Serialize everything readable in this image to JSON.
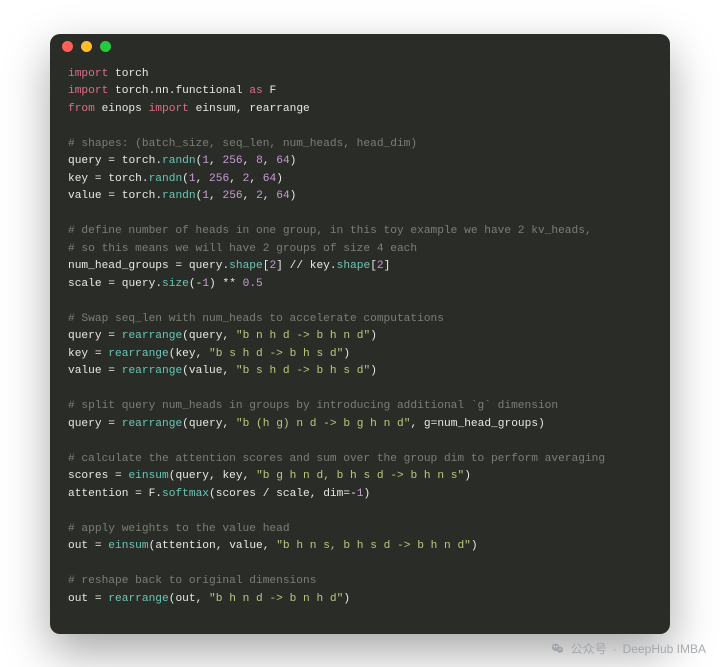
{
  "window": {
    "traffic_lights": [
      "close",
      "minimize",
      "zoom"
    ]
  },
  "code": {
    "lines": [
      {
        "t": [
          [
            "kw",
            "import"
          ],
          [
            "op",
            " "
          ],
          [
            "mod",
            "torch"
          ]
        ]
      },
      {
        "t": [
          [
            "kw",
            "import"
          ],
          [
            "op",
            " "
          ],
          [
            "mod",
            "torch.nn.functional"
          ],
          [
            "op",
            " "
          ],
          [
            "kw",
            "as"
          ],
          [
            "op",
            " "
          ],
          [
            "mod",
            "F"
          ]
        ]
      },
      {
        "t": [
          [
            "kw",
            "from"
          ],
          [
            "op",
            " "
          ],
          [
            "mod",
            "einops"
          ],
          [
            "op",
            " "
          ],
          [
            "kw",
            "import"
          ],
          [
            "op",
            " "
          ],
          [
            "mod",
            "einsum, rearrange"
          ]
        ]
      },
      {
        "t": [
          [
            "op",
            ""
          ]
        ]
      },
      {
        "t": [
          [
            "cmt",
            "# shapes: (batch_size, seq_len, num_heads, head_dim)"
          ]
        ]
      },
      {
        "t": [
          [
            "id",
            "query "
          ],
          [
            "op",
            "= "
          ],
          [
            "id",
            "torch"
          ],
          [
            "op",
            "."
          ],
          [
            "fn",
            "randn"
          ],
          [
            "op",
            "("
          ],
          [
            "num",
            "1"
          ],
          [
            "op",
            ", "
          ],
          [
            "num",
            "256"
          ],
          [
            "op",
            ", "
          ],
          [
            "num",
            "8"
          ],
          [
            "op",
            ", "
          ],
          [
            "num",
            "64"
          ],
          [
            "op",
            ")"
          ]
        ]
      },
      {
        "t": [
          [
            "id",
            "key "
          ],
          [
            "op",
            "= "
          ],
          [
            "id",
            "torch"
          ],
          [
            "op",
            "."
          ],
          [
            "fn",
            "randn"
          ],
          [
            "op",
            "("
          ],
          [
            "num",
            "1"
          ],
          [
            "op",
            ", "
          ],
          [
            "num",
            "256"
          ],
          [
            "op",
            ", "
          ],
          [
            "num",
            "2"
          ],
          [
            "op",
            ", "
          ],
          [
            "num",
            "64"
          ],
          [
            "op",
            ")"
          ]
        ]
      },
      {
        "t": [
          [
            "id",
            "value "
          ],
          [
            "op",
            "= "
          ],
          [
            "id",
            "torch"
          ],
          [
            "op",
            "."
          ],
          [
            "fn",
            "randn"
          ],
          [
            "op",
            "("
          ],
          [
            "num",
            "1"
          ],
          [
            "op",
            ", "
          ],
          [
            "num",
            "256"
          ],
          [
            "op",
            ", "
          ],
          [
            "num",
            "2"
          ],
          [
            "op",
            ", "
          ],
          [
            "num",
            "64"
          ],
          [
            "op",
            ")"
          ]
        ]
      },
      {
        "t": [
          [
            "op",
            ""
          ]
        ]
      },
      {
        "t": [
          [
            "cmt",
            "# define number of heads in one group, in this toy example we have 2 kv_heads,"
          ]
        ]
      },
      {
        "t": [
          [
            "cmt",
            "# so this means we will have 2 groups of size 4 each"
          ]
        ]
      },
      {
        "t": [
          [
            "id",
            "num_head_groups "
          ],
          [
            "op",
            "= "
          ],
          [
            "id",
            "query"
          ],
          [
            "op",
            "."
          ],
          [
            "fn",
            "shape"
          ],
          [
            "op",
            "["
          ],
          [
            "num",
            "2"
          ],
          [
            "op",
            "] // "
          ],
          [
            "id",
            "key"
          ],
          [
            "op",
            "."
          ],
          [
            "fn",
            "shape"
          ],
          [
            "op",
            "["
          ],
          [
            "num",
            "2"
          ],
          [
            "op",
            "]"
          ]
        ]
      },
      {
        "t": [
          [
            "id",
            "scale "
          ],
          [
            "op",
            "= "
          ],
          [
            "id",
            "query"
          ],
          [
            "op",
            "."
          ],
          [
            "fn",
            "size"
          ],
          [
            "op",
            "("
          ],
          [
            "op",
            "-"
          ],
          [
            "num",
            "1"
          ],
          [
            "op",
            ") ** "
          ],
          [
            "num",
            "0.5"
          ]
        ]
      },
      {
        "t": [
          [
            "op",
            ""
          ]
        ]
      },
      {
        "t": [
          [
            "cmt",
            "# Swap seq_len with num_heads to accelerate computations"
          ]
        ]
      },
      {
        "t": [
          [
            "id",
            "query "
          ],
          [
            "op",
            "= "
          ],
          [
            "fn",
            "rearrange"
          ],
          [
            "op",
            "("
          ],
          [
            "id",
            "query"
          ],
          [
            "op",
            ", "
          ],
          [
            "str",
            "\"b n h d -> b h n d\""
          ],
          [
            "op",
            ")"
          ]
        ]
      },
      {
        "t": [
          [
            "id",
            "key "
          ],
          [
            "op",
            "= "
          ],
          [
            "fn",
            "rearrange"
          ],
          [
            "op",
            "("
          ],
          [
            "id",
            "key"
          ],
          [
            "op",
            ", "
          ],
          [
            "str",
            "\"b s h d -> b h s d\""
          ],
          [
            "op",
            ")"
          ]
        ]
      },
      {
        "t": [
          [
            "id",
            "value "
          ],
          [
            "op",
            "= "
          ],
          [
            "fn",
            "rearrange"
          ],
          [
            "op",
            "("
          ],
          [
            "id",
            "value"
          ],
          [
            "op",
            ", "
          ],
          [
            "str",
            "\"b s h d -> b h s d\""
          ],
          [
            "op",
            ")"
          ]
        ]
      },
      {
        "t": [
          [
            "op",
            ""
          ]
        ]
      },
      {
        "t": [
          [
            "cmt",
            "# split query num_heads in groups by introducing additional `g` dimension"
          ]
        ]
      },
      {
        "t": [
          [
            "id",
            "query "
          ],
          [
            "op",
            "= "
          ],
          [
            "fn",
            "rearrange"
          ],
          [
            "op",
            "("
          ],
          [
            "id",
            "query"
          ],
          [
            "op",
            ", "
          ],
          [
            "str",
            "\"b (h g) n d -> b g h n d\""
          ],
          [
            "op",
            ", "
          ],
          [
            "id",
            "g"
          ],
          [
            "op",
            "="
          ],
          [
            "id",
            "num_head_groups"
          ],
          [
            "op",
            ")"
          ]
        ]
      },
      {
        "t": [
          [
            "op",
            ""
          ]
        ]
      },
      {
        "t": [
          [
            "cmt",
            "# calculate the attention scores and sum over the group dim to perform averaging"
          ]
        ]
      },
      {
        "t": [
          [
            "id",
            "scores "
          ],
          [
            "op",
            "= "
          ],
          [
            "fn",
            "einsum"
          ],
          [
            "op",
            "("
          ],
          [
            "id",
            "query"
          ],
          [
            "op",
            ", "
          ],
          [
            "id",
            "key"
          ],
          [
            "op",
            ", "
          ],
          [
            "str",
            "\"b g h n d, b h s d -> b h n s\""
          ],
          [
            "op",
            ")"
          ]
        ]
      },
      {
        "t": [
          [
            "id",
            "attention "
          ],
          [
            "op",
            "= "
          ],
          [
            "id",
            "F"
          ],
          [
            "op",
            "."
          ],
          [
            "fn",
            "softmax"
          ],
          [
            "op",
            "("
          ],
          [
            "id",
            "scores "
          ],
          [
            "op",
            "/ "
          ],
          [
            "id",
            "scale"
          ],
          [
            "op",
            ", "
          ],
          [
            "id",
            "dim"
          ],
          [
            "op",
            "="
          ],
          [
            "op",
            "-"
          ],
          [
            "num",
            "1"
          ],
          [
            "op",
            ")"
          ]
        ]
      },
      {
        "t": [
          [
            "op",
            ""
          ]
        ]
      },
      {
        "t": [
          [
            "cmt",
            "# apply weights to the value head"
          ]
        ]
      },
      {
        "t": [
          [
            "id",
            "out "
          ],
          [
            "op",
            "= "
          ],
          [
            "fn",
            "einsum"
          ],
          [
            "op",
            "("
          ],
          [
            "id",
            "attention"
          ],
          [
            "op",
            ", "
          ],
          [
            "id",
            "value"
          ],
          [
            "op",
            ", "
          ],
          [
            "str",
            "\"b h n s, b h s d -> b h n d\""
          ],
          [
            "op",
            ")"
          ]
        ]
      },
      {
        "t": [
          [
            "op",
            ""
          ]
        ]
      },
      {
        "t": [
          [
            "cmt",
            "# reshape back to original dimensions"
          ]
        ]
      },
      {
        "t": [
          [
            "id",
            "out "
          ],
          [
            "op",
            "= "
          ],
          [
            "fn",
            "rearrange"
          ],
          [
            "op",
            "("
          ],
          [
            "id",
            "out"
          ],
          [
            "op",
            ", "
          ],
          [
            "str",
            "\"b h n d -> b n h d\""
          ],
          [
            "op",
            ")"
          ]
        ]
      }
    ]
  },
  "watermark": {
    "prefix": "公众号",
    "sep": "·",
    "name": "DeepHub IMBA"
  }
}
